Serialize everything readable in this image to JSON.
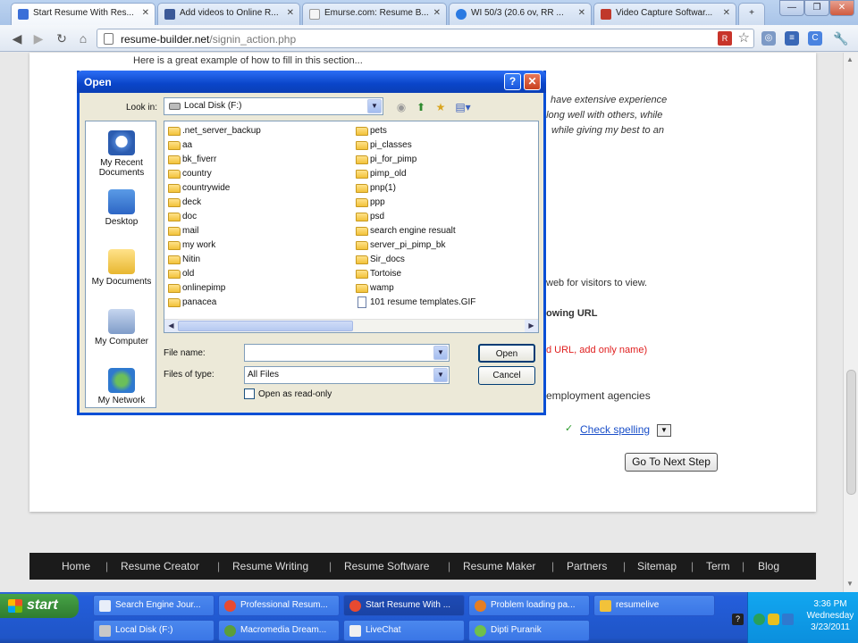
{
  "browser": {
    "tabs": [
      {
        "label": "Start Resume With Res...",
        "active": true
      },
      {
        "label": "Add videos to Online R..."
      },
      {
        "label": "Emurse.com: Resume B..."
      },
      {
        "label": "WI 50/3 (20.6 ov, RR ..."
      },
      {
        "label": "Video Capture Softwar..."
      }
    ],
    "address": {
      "domain": "resume-builder.net",
      "path": "/signin_action.php"
    },
    "colors": {
      "tab_strip": "#a9c4e8",
      "accent": "#0a4fd5"
    }
  },
  "page": {
    "example_text": "Here is a great example of how to fill in this section...",
    "italic_lines": [
      "have extensive experience",
      "along well with others, while",
      "while giving my best to an"
    ],
    "web_visitors": "web for visitors to view.",
    "following_url": "owing URL",
    "url_hint": "d URL, add only name)",
    "agencies": "employment agencies",
    "check_spelling": "Check spelling",
    "next_step_button": "Go To Next Step"
  },
  "footer_nav": [
    "Home",
    "Resume Creator",
    "Resume Writing",
    "Resume Software",
    "Resume Maker",
    "Partners",
    "Sitemap",
    "Term",
    "Blog"
  ],
  "dialog": {
    "title": "Open",
    "look_in_label": "Look in:",
    "look_in_value": "Local Disk (F:)",
    "places": [
      "My Recent Documents",
      "Desktop",
      "My Documents",
      "My Computer",
      "My Network"
    ],
    "files_col1": [
      ".net_server_backup",
      "aa",
      "bk_fiverr",
      "country",
      "countrywide",
      "deck",
      "doc",
      "mail",
      "my work",
      "Nitin",
      "old",
      "onlinepimp",
      "panacea"
    ],
    "files_col2": [
      "pets",
      "pi_classes",
      "pi_for_pimp",
      "pimp_old",
      "pnp(1)",
      "ppp",
      "psd",
      "search engine resualt",
      "server_pi_pimp_bk",
      "Sir_docs",
      "Tortoise",
      "wamp",
      "101 resume templates.GIF"
    ],
    "file_name_label": "File name:",
    "file_name_value": "",
    "files_of_type_label": "Files of type:",
    "files_of_type_value": "All Files",
    "readonly_label": "Open as read-only",
    "open_button": "Open",
    "cancel_button": "Cancel"
  },
  "taskbar": {
    "start_label": "start",
    "tasks_row1": [
      "Search Engine Jour...",
      "Professional Resum...",
      "Start Resume With ...",
      "Problem loading pa...",
      "resumelive"
    ],
    "tasks_row2": [
      "Local Disk (F:)",
      "Macromedia Dream...",
      "LiveChat",
      "Dipti Puranik"
    ],
    "clock_time": "3:36 PM",
    "clock_day": "Wednesday",
    "clock_date": "3/23/2011"
  }
}
